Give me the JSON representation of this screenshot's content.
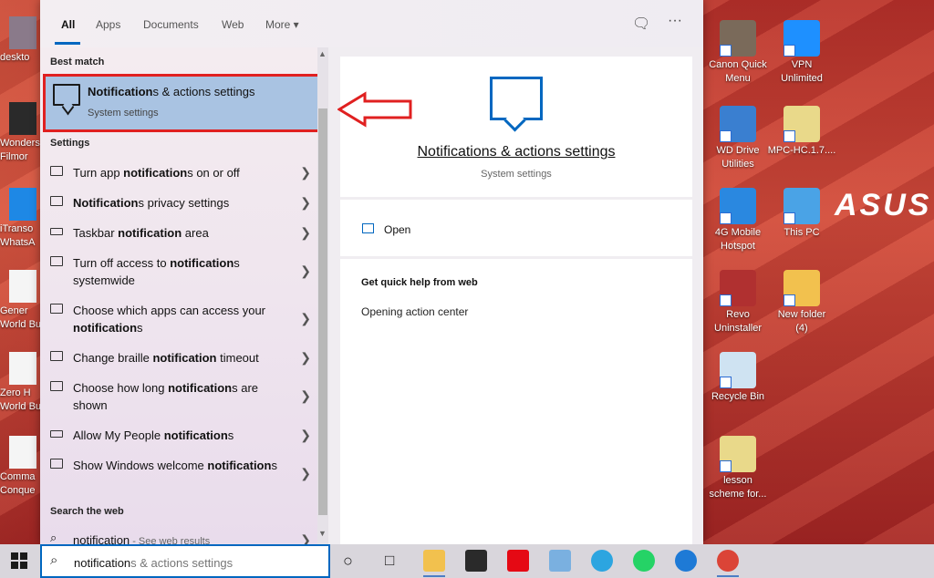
{
  "desktop": {
    "brand": "ASUS",
    "left_icons": [
      {
        "label": "deskto"
      },
      {
        "label": "Wonders",
        "label2": "Filmor"
      },
      {
        "label": "iTranso",
        "label2": "WhatsA"
      },
      {
        "label": "Gener",
        "label2": "World Bu"
      },
      {
        "label": "Zero H",
        "label2": "World Bu"
      },
      {
        "label": "Comma",
        "label2": "Conque"
      }
    ],
    "icons": [
      {
        "l1": "Canon Quick",
        "l2": "Menu",
        "color": "#7a6a5a"
      },
      {
        "l1": "VPN",
        "l2": "Unlimited",
        "color": "#1e90ff"
      },
      {
        "l1": "WD Drive",
        "l2": "Utilities",
        "color": "#3a7fd0"
      },
      {
        "l1": "MPC-HC.1.7....",
        "l2": "",
        "color": "#e9d98a"
      },
      {
        "l1": "4G Mobile",
        "l2": "Hotspot",
        "color": "#2a88e0"
      },
      {
        "l1": "This PC",
        "l2": "",
        "color": "#4aa3e6"
      },
      {
        "l1": "Revo",
        "l2": "Uninstaller",
        "color": "#b03030"
      },
      {
        "l1": "New folder",
        "l2": "(4)",
        "color": "#f2c14e"
      },
      {
        "l1": "Recycle Bin",
        "l2": "",
        "color": "#cfe3f2"
      },
      {
        "l1": "lesson",
        "l2": "scheme for...",
        "color": "#e9d98a"
      }
    ]
  },
  "search": {
    "tabs": [
      "All",
      "Apps",
      "Documents",
      "Web",
      "More ▾"
    ],
    "feedback_icon": "feedback-icon",
    "more_options": "···",
    "best_match_heading": "Best match",
    "best_match": {
      "title_bold": "Notification",
      "title_rest": "s & actions settings",
      "subtitle": "System settings"
    },
    "settings_heading": "Settings",
    "settings": [
      {
        "pre": "Turn app ",
        "bold": "notification",
        "post": "s on or off",
        "lines": 1,
        "icon": "chat"
      },
      {
        "pre": "",
        "bold": "Notification",
        "post": "s privacy settings",
        "lines": 1,
        "icon": "chat"
      },
      {
        "pre": "Taskbar ",
        "bold": "notification",
        "post": " area",
        "lines": 1,
        "icon": "bar"
      },
      {
        "pre": "Turn off access to ",
        "bold": "notification",
        "post": "s systemwide",
        "lines": 2,
        "icon": "chat"
      },
      {
        "pre": "Choose which apps can access your ",
        "bold": "notification",
        "post": "s",
        "lines": 2,
        "icon": "chat"
      },
      {
        "pre": "Change braille ",
        "bold": "notification",
        "post": " timeout",
        "lines": 1,
        "icon": "chat"
      },
      {
        "pre": "Choose how long ",
        "bold": "notification",
        "post": "s are shown",
        "lines": 2,
        "icon": "monitor"
      },
      {
        "pre": "Allow My People ",
        "bold": "notification",
        "post": "s",
        "lines": 1,
        "icon": "bar"
      },
      {
        "pre": "Show Windows welcome ",
        "bold": "notification",
        "post": "s",
        "lines": 2,
        "icon": "monitor"
      }
    ],
    "web_heading": "Search the web",
    "web_item": {
      "query": "notification",
      "suffix": " - See web results"
    },
    "preview": {
      "title": "Notifications & actions settings",
      "subtitle": "System settings",
      "open_label": "Open",
      "help_heading": "Get quick help from web",
      "help_item": "Opening action center"
    },
    "query_typed": "notification",
    "query_ghost": "s & actions settings"
  },
  "taskbar": {
    "apps": [
      {
        "name": "task-view-icon",
        "glyph": "□"
      },
      {
        "name": "file-explorer-icon",
        "color": "#f2c14e"
      },
      {
        "name": "store-icon",
        "color": "#2a2a2a"
      },
      {
        "name": "netflix-icon",
        "color": "#e50914"
      },
      {
        "name": "paint-icon",
        "color": "#7ab0e0"
      },
      {
        "name": "telegram-icon",
        "color": "#2ca5e0"
      },
      {
        "name": "whatsapp-icon",
        "color": "#25d366"
      },
      {
        "name": "edge-icon",
        "color": "#1e7ad6"
      },
      {
        "name": "chrome-icon",
        "color": "#db4437"
      }
    ]
  }
}
